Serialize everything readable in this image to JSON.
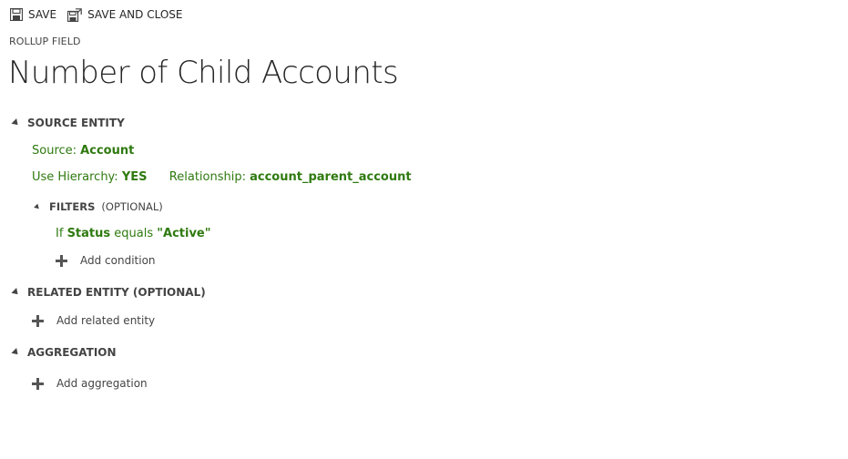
{
  "toolbar": {
    "save_label": "SAVE",
    "save_close_label": "SAVE AND CLOSE"
  },
  "header": {
    "subtitle": "ROLLUP FIELD",
    "title": "Number of Child Accounts"
  },
  "source_entity": {
    "heading": "SOURCE ENTITY",
    "source_label": "Source:",
    "source_value": "Account",
    "hierarchy_label": "Use Hierarchy:",
    "hierarchy_value": "YES",
    "relationship_label": "Relationship:",
    "relationship_value": "account_parent_account",
    "filters": {
      "heading": "FILTERS",
      "optional": "(OPTIONAL)",
      "condition": {
        "if_word": "If",
        "field": "Status",
        "operator": "equals",
        "value": "\"Active\""
      },
      "add_label": "Add condition"
    }
  },
  "related_entity": {
    "heading": "RELATED ENTITY (OPTIONAL)",
    "add_label": "Add related entity"
  },
  "aggregation": {
    "heading": "AGGREGATION",
    "add_label": "Add aggregation"
  },
  "colors": {
    "accent_green": "#2f7a10",
    "text": "#444444"
  }
}
